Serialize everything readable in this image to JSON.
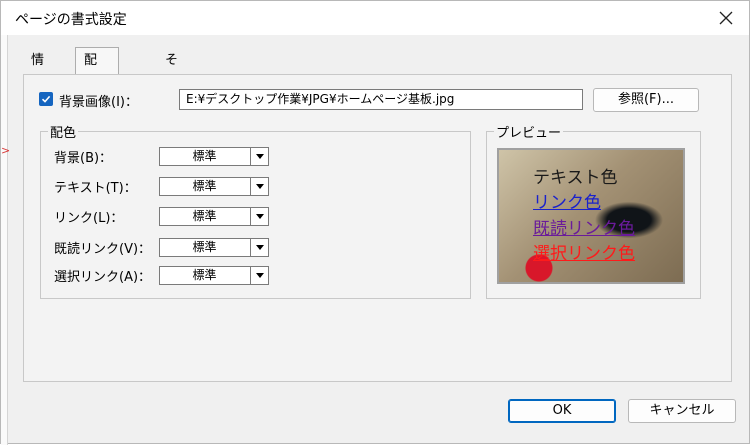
{
  "window": {
    "title": "ページの書式設定"
  },
  "tabs": [
    {
      "label": "情報"
    },
    {
      "label": "配色・背景"
    },
    {
      "label": "その他"
    }
  ],
  "background_image": {
    "checked": true,
    "label": "背景画像(I)：",
    "path": "E:¥デスクトップ作業¥JPG¥ホームページ基板.jpg",
    "browse_label": "参照(F)..."
  },
  "colors": {
    "legend": "配色",
    "rows": [
      {
        "label": "背景(B)：",
        "value": "標準"
      },
      {
        "label": "テキスト(T)：",
        "value": "標準"
      },
      {
        "label": "リンク(L)：",
        "value": "標準"
      },
      {
        "label": "既読リンク(V)：",
        "value": "標準"
      },
      {
        "label": "選択リンク(A)：",
        "value": "標準"
      }
    ]
  },
  "preview": {
    "legend": "プレビュー",
    "text_sample": "テキスト色",
    "link_sample": "リンク色",
    "visited_sample": "既読リンク色",
    "active_sample": "選択リンク色",
    "colors": {
      "text": "#1a1a1a",
      "link": "#1a22cc",
      "visited": "#6a1b9a",
      "active": "#ff1a1a"
    }
  },
  "buttons": {
    "ok": "OK",
    "cancel": "キャンセル"
  },
  "accent_color": "#0067c0"
}
